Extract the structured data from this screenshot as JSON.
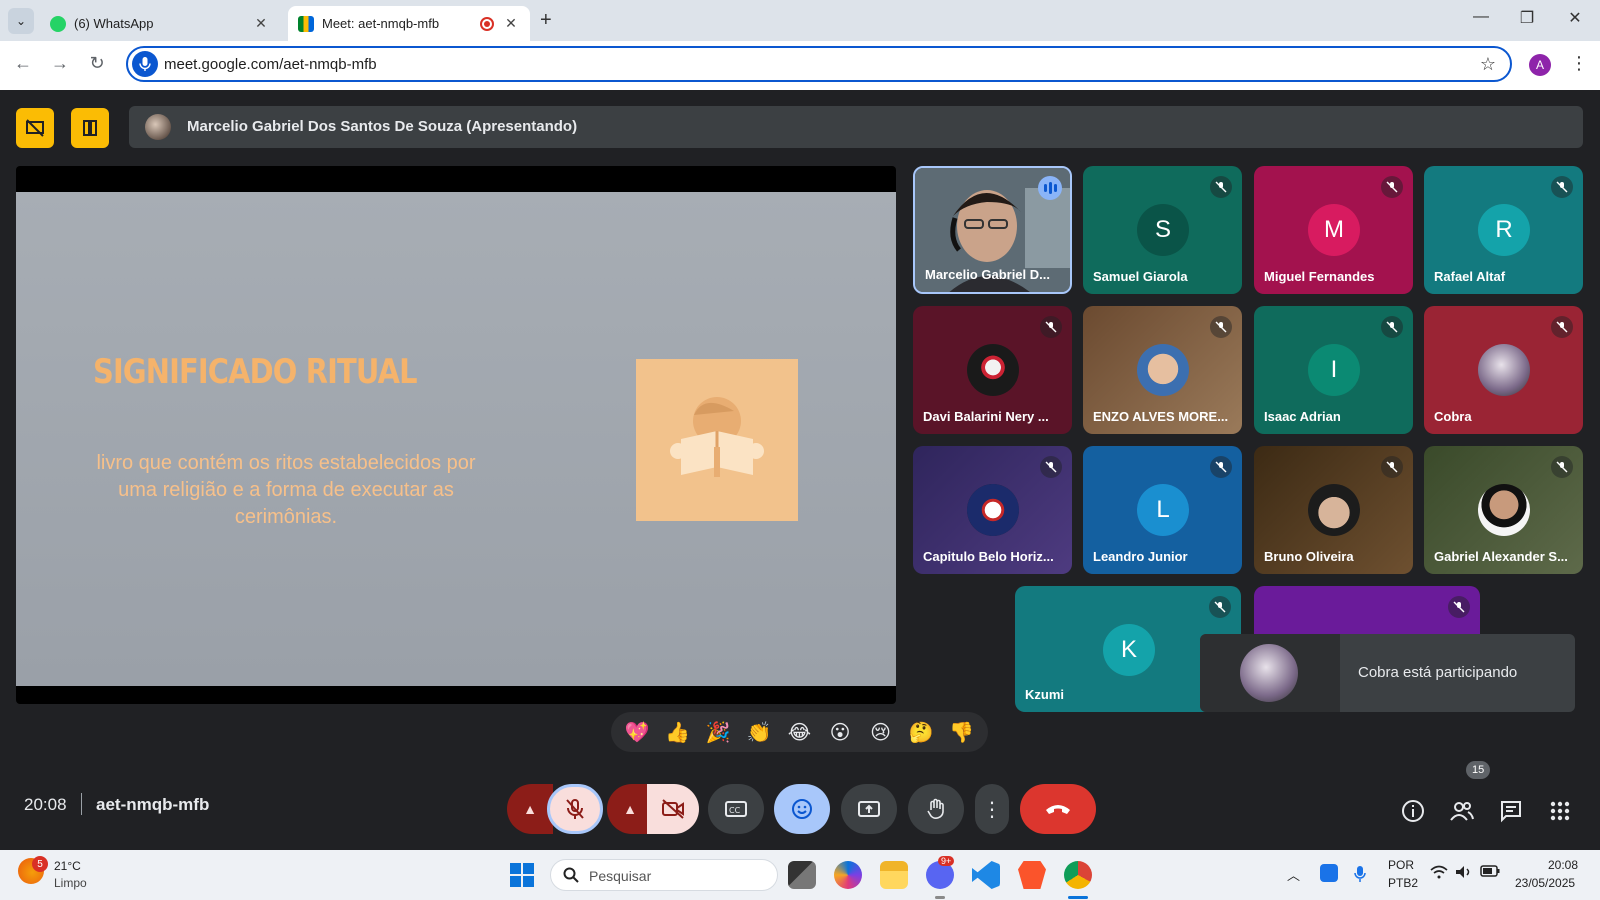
{
  "browser": {
    "tabs": [
      {
        "title": "(6) WhatsApp"
      },
      {
        "title": "Meet: aet-nmqb-mfb"
      }
    ],
    "url": "meet.google.com/aet-nmqb-mfb",
    "profile_initial": "A"
  },
  "meet": {
    "presenter_text": "Marcelio Gabriel Dos Santos De Souza (Apresentando)",
    "slide": {
      "title": "SIGNIFICADO RITUAL",
      "body": "livro que contém os ritos estabelecidos por uma religião e a forma de executar as cerimônias."
    },
    "participants": [
      {
        "name": "Marcelio Gabriel D...",
        "speaking": true
      },
      {
        "name": "Samuel Giarola",
        "initial": "S",
        "bg": "#0f6b5c",
        "avatar_color": "#0a5448"
      },
      {
        "name": "Miguel Fernandes",
        "initial": "M",
        "bg": "#a3124e",
        "avatar_color": "#d81b60"
      },
      {
        "name": "Rafael Altaf",
        "initial": "R",
        "bg": "#137a7f",
        "avatar_color": "#14a3aa"
      },
      {
        "name": "Davi Balarini Nery ...",
        "bg": "#5a1428"
      },
      {
        "name": "ENZO ALVES MORE...",
        "bg": "#7a5a3a"
      },
      {
        "name": "Isaac Adrian",
        "initial": "I",
        "bg": "#0f6b5c",
        "avatar_color": "#0b8a73"
      },
      {
        "name": "Cobra",
        "bg": "#9a2434"
      },
      {
        "name": "Capitulo Belo Horiz...",
        "bg": "#3d2f6e"
      },
      {
        "name": "Leandro Junior",
        "initial": "L",
        "bg": "#1460a0",
        "avatar_color": "#1a8fd0"
      },
      {
        "name": "Bruno Oliveira",
        "bg": "#5a3e1e"
      },
      {
        "name": "Gabriel Alexander S...",
        "bg": "#4a5a3a"
      },
      {
        "name": "Kzumi",
        "initial": "K",
        "bg": "#137a7f",
        "avatar_color": "#14a3aa"
      },
      {
        "name": "",
        "bg": "#6a1b9a"
      }
    ],
    "toast": "Cobra está participando",
    "reactions": [
      "💖",
      "👍",
      "🎉",
      "👏",
      "😂",
      "😮",
      "😢",
      "🤔",
      "👎"
    ],
    "clock": "20:08",
    "meeting_code": "aet-nmqb-mfb",
    "people_count": "15"
  },
  "taskbar": {
    "weather_badge": "5",
    "temperature": "21°C",
    "condition": "Limpo",
    "search_placeholder": "Pesquisar",
    "chat_badge": "9+",
    "lang_line1": "POR",
    "lang_line2": "PTB2",
    "time": "20:08",
    "date": "23/05/2025"
  }
}
